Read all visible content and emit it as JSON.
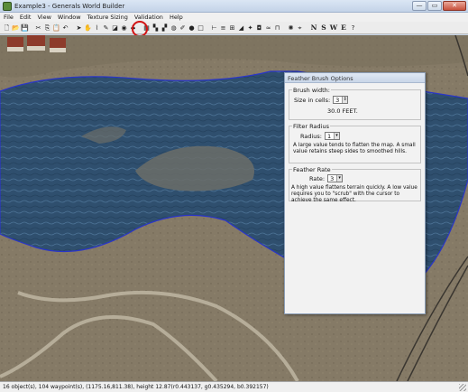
{
  "window": {
    "title": "Example3 - Generals World Builder",
    "buttons": {
      "minimize": "—",
      "maximize": "▭",
      "close": "✕"
    }
  },
  "menu": [
    "File",
    "Edit",
    "View",
    "Window",
    "Texture Sizing",
    "Validation",
    "Help"
  ],
  "toolbar": {
    "icons": [
      "new-icon",
      "open-icon",
      "save-icon",
      "sep",
      "cut-icon",
      "copy-icon",
      "paste-icon",
      "undo-icon",
      "sep",
      "pointer-icon",
      "hand-icon",
      "eyedropper-icon",
      "paint-brush-icon",
      "fill-icon",
      "feather-brush-icon",
      "grove-icon",
      "sep",
      "tile-icon",
      "checker-icon",
      "checker-alt-icon",
      "bucket-icon",
      "pen-icon",
      "dot-icon",
      "square-icon",
      "sep",
      "waypoint-icon",
      "road-icon",
      "grid-icon",
      "ramp-icon",
      "light-icon",
      "blend-icon",
      "water-icon",
      "bridge-icon",
      "sep",
      "scorch-icon",
      "camera-icon",
      "sep"
    ],
    "glyphs": {
      "new-icon": "🗋",
      "open-icon": "📂",
      "save-icon": "💾",
      "cut-icon": "✂",
      "copy-icon": "⎘",
      "paste-icon": "📋",
      "undo-icon": "↶",
      "pointer-icon": "➤",
      "hand-icon": "✋",
      "eyedropper-icon": "⌇",
      "paint-brush-icon": "✎",
      "fill-icon": "◪",
      "feather-brush-icon": "◉",
      "grove-icon": "♣",
      "tile-icon": "▦",
      "checker-icon": "▚",
      "checker-alt-icon": "▞",
      "bucket-icon": "◍",
      "pen-icon": "✐",
      "dot-icon": "●",
      "square-icon": "□",
      "waypoint-icon": "⊢",
      "road-icon": "≡",
      "grid-icon": "⊞",
      "ramp-icon": "◢",
      "light-icon": "✦",
      "blend-icon": "◘",
      "water-icon": "≈",
      "bridge-icon": "⊓",
      "scorch-icon": "✺",
      "camera-icon": "⌖"
    },
    "compass": [
      "N",
      "S",
      "W",
      "E"
    ],
    "help": "?"
  },
  "feather_panel": {
    "title": "Feather Brush Options",
    "brush_width": {
      "label": "Brush width:",
      "size_label": "Size in cells:",
      "size_value": "3",
      "feet": "30.0 FEET."
    },
    "filter_radius": {
      "label": "Filter Radius",
      "radius_label": "Radius:",
      "radius_value": "1",
      "note": "A large value tends to flatten the map. A small value retains steep sides to smoothed hills."
    },
    "feather_rate": {
      "label": "Feather Rate",
      "rate_label": "Rate:",
      "rate_value": "3",
      "note": "A high value flattens terrain quickly. A low value requires you to \"scrub\" with the cursor to achieve the same effect."
    }
  },
  "status": "16 object(s), 104 waypoint(s), (1175.16,811.38), height 12.87(r0.443137, g0.435294, b0.392157)",
  "colors": {
    "water": "#2f4f6e",
    "water_edge": "#2a35c8",
    "terrain": "#807462",
    "road": "#c2baa6",
    "panel_bg": "#f2f2f2"
  }
}
